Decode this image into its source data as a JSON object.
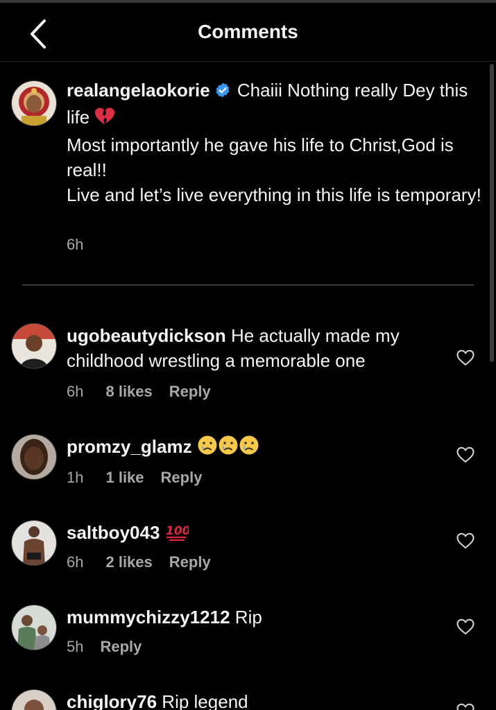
{
  "header": {
    "title": "Comments"
  },
  "caption": {
    "username": "realangelaokorie",
    "text_1": "Chaiii Nothing really Dey this life",
    "text_2": "Most importantly he gave his life to Christ,God is real!!",
    "text_3": "Live and let’s live everything in this life is temporary!",
    "time": "6h",
    "verified_color": "#3897f0"
  },
  "comments": [
    {
      "username": "ugobeautydickson",
      "text": "He actually made my childhood wrestling a memorable one",
      "time": "6h",
      "likes": "8 likes",
      "reply": "Reply"
    },
    {
      "username": "promzy_glamz",
      "text": "",
      "emoji": "crying-face ×3",
      "time": "1h",
      "likes": "1 like",
      "reply": "Reply"
    },
    {
      "username": "saltboy043",
      "text": "",
      "emoji": "hundred-points",
      "time": "6h",
      "likes": "2 likes",
      "reply": "Reply"
    },
    {
      "username": "mummychizzy1212",
      "text": "Rip",
      "time": "5h",
      "likes": "",
      "reply": "Reply"
    },
    {
      "username": "chiglory76",
      "text": "Rip legend",
      "time": "",
      "likes": "",
      "reply": ""
    }
  ],
  "colors": {
    "background": "#000000",
    "text": "#f5f5f5",
    "secondary": "#a8a8a8",
    "divider": "#3a3a3a"
  }
}
